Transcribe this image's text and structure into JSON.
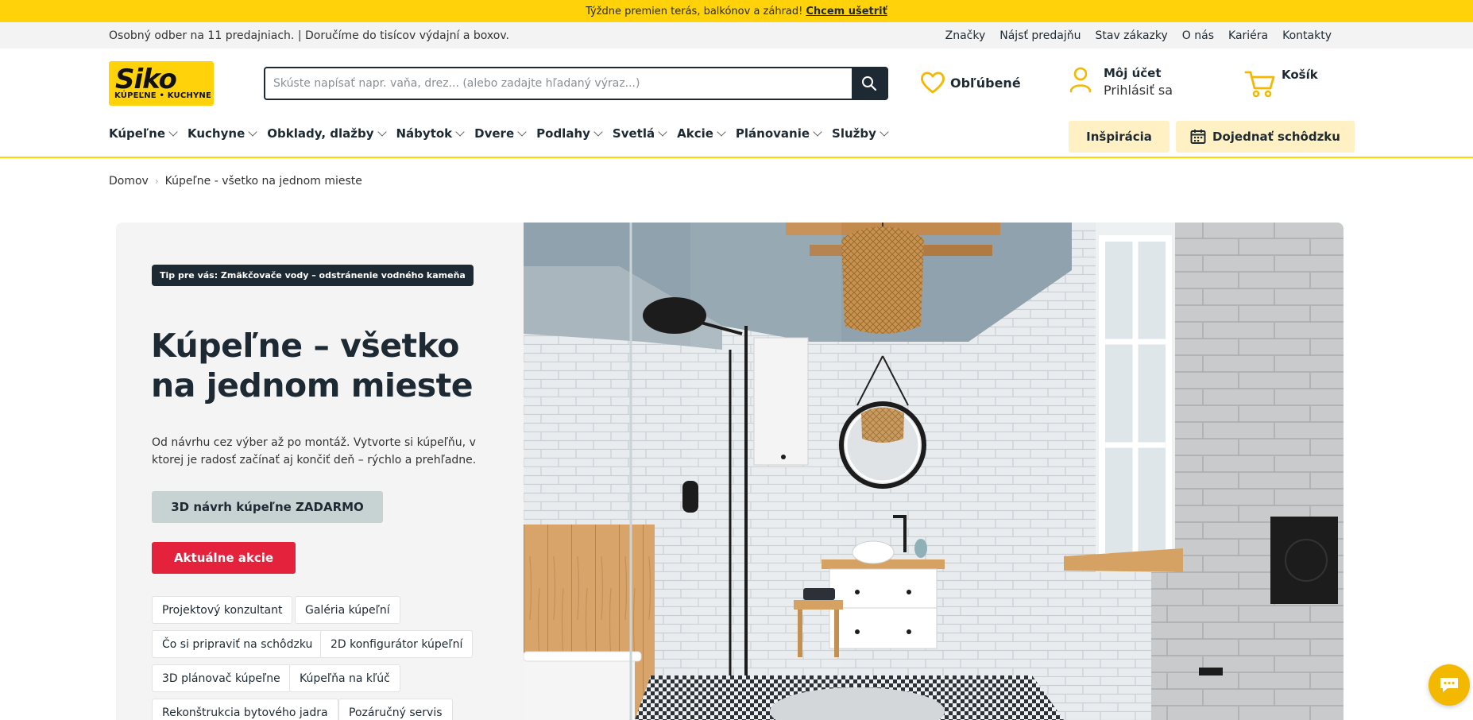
{
  "promo": {
    "text": "Týždne premien terás, balkónov a záhrad!",
    "cta": "Chcem ušetriť"
  },
  "utility": {
    "left_text": "Osobný odber na 11 predajniach. | Doručíme do tisícov výdajní a boxov.",
    "links": [
      "Značky",
      "Nájsť predajňu",
      "Stav zákazky",
      "O nás",
      "Kariéra",
      "Kontakty"
    ]
  },
  "header": {
    "logo_word": "Siko",
    "logo_sub": "KÚPEĽNE • KUCHYNE",
    "search_placeholder": "Skúste napísať napr. vaňa, drez... (alebo zadajte hľadaný výraz...)",
    "favorites_label": "Obľúbené",
    "account_title": "Môj účet",
    "account_sub": "Prihlásiť sa",
    "cart_label": "Košík"
  },
  "nav": {
    "items": [
      "Kúpeľne",
      "Kuchyne",
      "Obklady, dlažby",
      "Nábytok",
      "Dvere",
      "Podlahy",
      "Svetlá",
      "Akcie",
      "Plánovanie",
      "Služby"
    ],
    "inspiration": "Inšpirácia",
    "appointment": "Dojednať schôdzku"
  },
  "breadcrumb": [
    "Domov",
    "Kúpeľne - všetko na jednom mieste"
  ],
  "hero": {
    "tip": "Tip pre vás: Zmäkčovače vody – odstránenie vodného kameňa",
    "title": "Kúpeľne – všetko na jednom mieste",
    "description": "Od návrhu cez výber až po montáž. Vytvorte si kúpeľňu, v ktorej je radosť začínať aj končiť deň – rýchlo a prehľadne.",
    "btn_3d": "3D návrh kúpeľne ZADARMO",
    "btn_akcie": "Aktuálne akcie",
    "chips": [
      "Projektový konzultant",
      "Galéria kúpeľní",
      "Čo si pripraviť na schôdzku",
      "2D konfigurátor kúpeľní",
      "3D plánovač kúpeľne",
      "Kúpeľňa na kľúč",
      "Rekonštrukcia bytového jadra",
      "Pozáručný servis"
    ]
  },
  "colors": {
    "brand_yellow": "#ffd20a",
    "dark": "#1e2a33",
    "red": "#e4223b",
    "light_yellow": "#fff1c4"
  },
  "icons": [
    "search-icon",
    "heart-icon",
    "user-icon",
    "cart-icon",
    "calendar-icon",
    "chat-icon"
  ]
}
